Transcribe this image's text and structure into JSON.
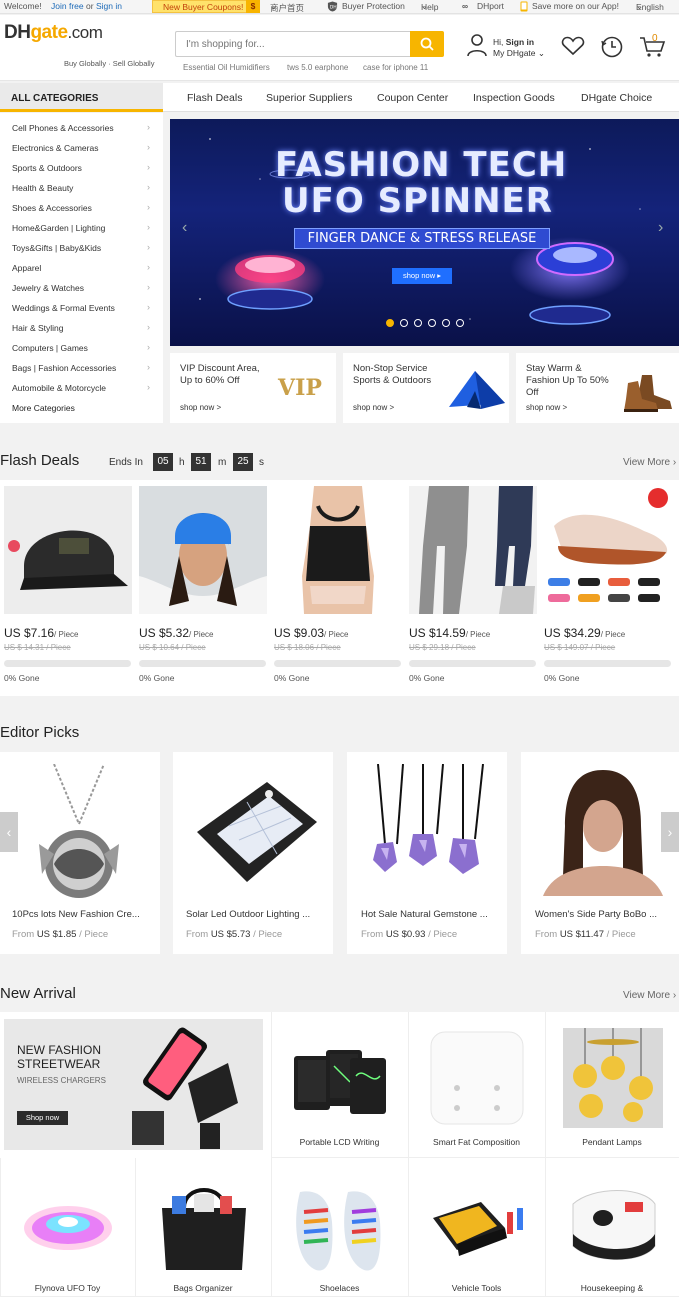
{
  "topbar": {
    "welcome": "Welcome!",
    "join_free": "Join free",
    "or": "or",
    "sign_in": "Sign in",
    "coupon": "New Buyer Coupons!",
    "coupon_symbol": "$",
    "home_cn": "商户首页",
    "buyer_protection": "Buyer Protection",
    "help": "Help",
    "dhport": "DHport",
    "app": "Save more on our App!",
    "language": "English"
  },
  "header": {
    "logo_dh": "DH",
    "logo_gate": "gate",
    "logo_com": ".com",
    "slogan": "Buy Globally · Sell Globally",
    "search_placeholder": "I'm shopping for...",
    "hot_keywords": [
      "Essential Oil Humidifiers",
      "tws 5.0 earphone",
      "case for iphone 11"
    ],
    "greeting": "Hi,",
    "sign_in": "Sign in",
    "my_dhgate": "My DHgate",
    "cart_count": "0"
  },
  "nav": {
    "all_categories": "ALL CATEGORIES",
    "items": [
      "Flash Deals",
      "Superior Suppliers",
      "Coupon Center",
      "Inspection Goods",
      "DHgate Choice"
    ]
  },
  "sidebar": {
    "categories": [
      "Cell Phones & Accessories",
      "Electronics & Cameras",
      "Sports & Outdoors",
      "Health & Beauty",
      "Shoes & Accessories",
      "Home&Garden  | Lighting",
      "Toys&Gifts  | Baby&Kids",
      "Apparel",
      "Jewelry & Watches",
      "Weddings & Formal Events",
      "Hair & Styling",
      "Computers  | Games",
      "Bags  | Fashion Accessories",
      "Automobile & Motorcycle",
      "More Categories"
    ]
  },
  "banner": {
    "title_line1": "FASHION TECH",
    "title_line2": "UFO SPINNER",
    "subtitle": "FINGER DANCE & STRESS RELEASE",
    "button": "shop now ▸"
  },
  "promos": [
    {
      "title": "VIP Discount Area, Up to 60% Off",
      "link": "shop now >",
      "badge": "VIP"
    },
    {
      "title": "Non-Stop Service Sports & Outdoors",
      "link": "shop now >"
    },
    {
      "title": "Stay Warm & Fashion Up To 50% Off",
      "link": "shop now >"
    }
  ],
  "flash": {
    "title": "Flash Deals",
    "ends_in": "Ends In",
    "hours": "05",
    "h": "h",
    "minutes": "51",
    "m": "m",
    "seconds": "25",
    "s": "s",
    "view_more": "View More",
    "items": [
      {
        "price": "US $7.16",
        "unit": "/ Piece",
        "old": "US $ 14.31 / Piece",
        "gone": "0% Gone"
      },
      {
        "price": "US $5.32",
        "unit": "/ Piece",
        "old": "US $ 10.64 / Piece",
        "gone": "0% Gone"
      },
      {
        "price": "US $9.03",
        "unit": "/ Piece",
        "old": "US $ 18.06 / Piece",
        "gone": "0% Gone"
      },
      {
        "price": "US $14.59",
        "unit": "/ Piece",
        "old": "US $ 29.18 / Piece",
        "gone": "0% Gone"
      },
      {
        "price": "US $34.29",
        "unit": "/ Piece",
        "old": "US $ 149.07 / Piece",
        "gone": "0% Gone"
      }
    ]
  },
  "editor": {
    "title": "Editor Picks",
    "items": [
      {
        "name": "10Pcs lots New Fashion Cre...",
        "from": "From",
        "price": "US $1.85",
        "unit": "/ Piece"
      },
      {
        "name": "Solar Led Outdoor Lighting ...",
        "from": "From",
        "price": "US $5.73",
        "unit": "/ Piece"
      },
      {
        "name": "Hot Sale Natural Gemstone ...",
        "from": "From",
        "price": "US $0.93",
        "unit": "/ Piece"
      },
      {
        "name": "Women's Side Party BoBo ...",
        "from": "From",
        "price": "US $11.47",
        "unit": "/ Piece"
      }
    ]
  },
  "arrival": {
    "title": "New Arrival",
    "view_more": "View More",
    "feature_line1": "NEW FASHION",
    "feature_line2": "STREETWEAR",
    "feature_sub": "WIRELESS CHARGERS",
    "feature_button": "Shop now",
    "items": [
      "Portable LCD Writing",
      "Smart Fat Composition",
      "Pendant Lamps",
      "Flynova UFO Toy",
      "Bags Organizer",
      "Shoelaces",
      "Vehicle Tools",
      "Housekeeping &"
    ]
  }
}
